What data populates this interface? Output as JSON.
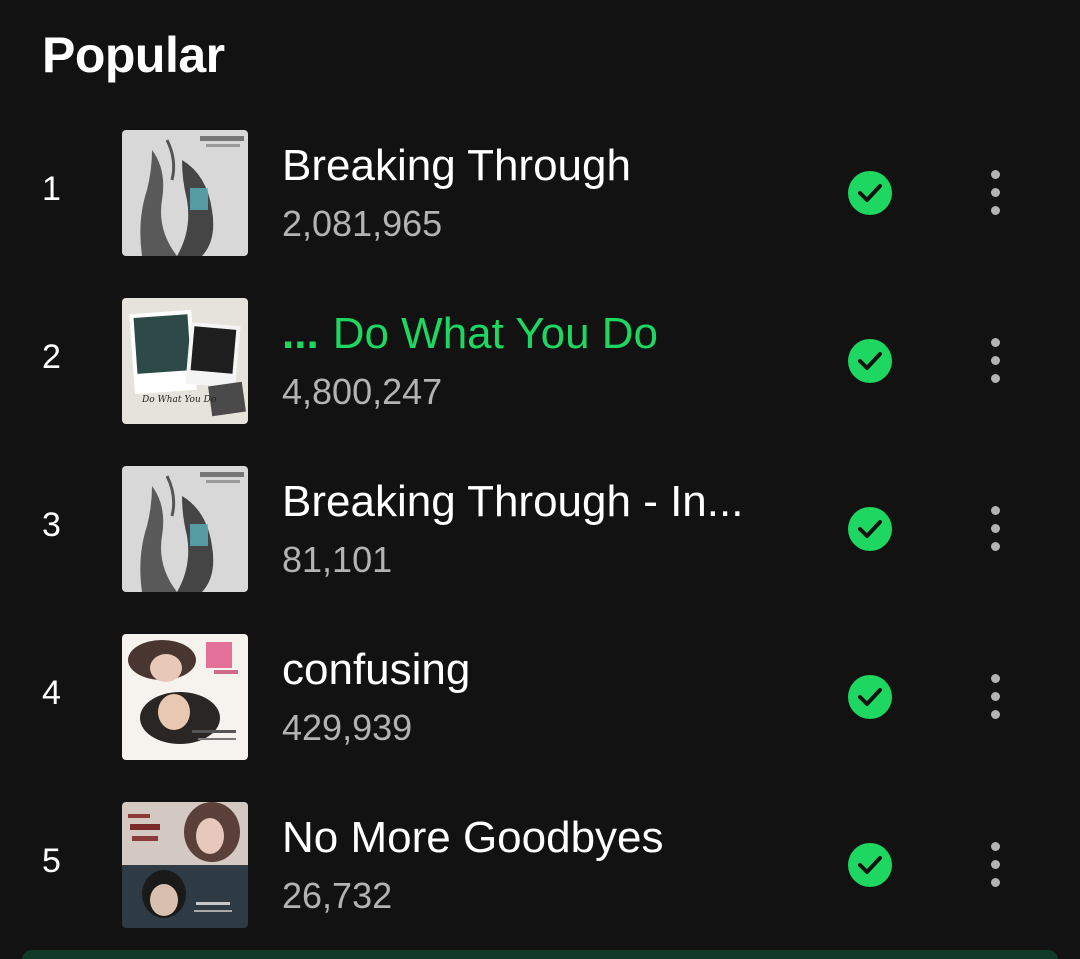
{
  "section": {
    "title": "Popular"
  },
  "tracks": [
    {
      "rank": "1",
      "title": "Breaking Through",
      "plays": "2,081,965",
      "playing": false,
      "art": "art-breaking"
    },
    {
      "rank": "2",
      "title": "Do What You Do",
      "plays": "4,800,247",
      "playing": true,
      "playing_indicator": "...",
      "art": "art-dowhat",
      "art_caption": "Do What You Do"
    },
    {
      "rank": "3",
      "title": "Breaking Through - In...",
      "plays": "81,101",
      "playing": false,
      "art": "art-breaking"
    },
    {
      "rank": "4",
      "title": "confusing",
      "plays": "429,939",
      "playing": false,
      "art": "art-confusing"
    },
    {
      "rank": "5",
      "title": "No More Goodbyes",
      "plays": "26,732",
      "playing": false,
      "art": "art-nomore"
    }
  ],
  "icons": {
    "downloaded": "check-circle-icon",
    "more": "more-vertical-icon"
  },
  "colors": {
    "background": "#121212",
    "accent": "#1ed760",
    "secondary_text": "#b3b3b3"
  }
}
